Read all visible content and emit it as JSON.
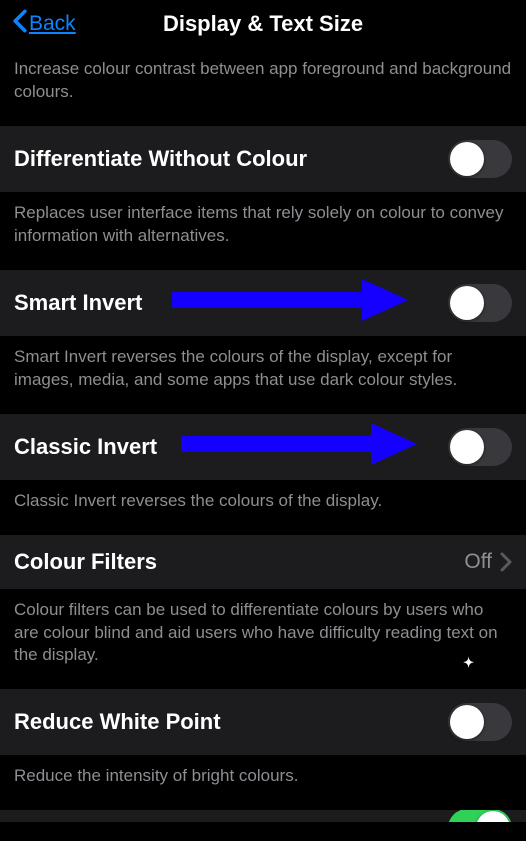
{
  "header": {
    "back_label": "Back",
    "title": "Display & Text Size"
  },
  "sections": {
    "contrast": {
      "footer": "Increase colour contrast between app foreground and background colours."
    },
    "diff_color": {
      "label": "Differentiate Without Colour",
      "footer": "Replaces user interface items that rely solely on colour to convey information with alternatives."
    },
    "smart_invert": {
      "label": "Smart Invert",
      "footer": "Smart Invert reverses the colours of the display, except for images, media, and some apps that use dark colour styles."
    },
    "classic_invert": {
      "label": "Classic Invert",
      "footer": "Classic Invert reverses the colours of the display."
    },
    "colour_filters": {
      "label": "Colour Filters",
      "value": "Off",
      "footer": "Colour filters can be used to differentiate colours by users who are colour blind and aid users who have difficulty reading text on the display."
    },
    "reduce_white_point": {
      "label": "Reduce White Point",
      "footer": "Reduce the intensity of bright colours."
    }
  }
}
